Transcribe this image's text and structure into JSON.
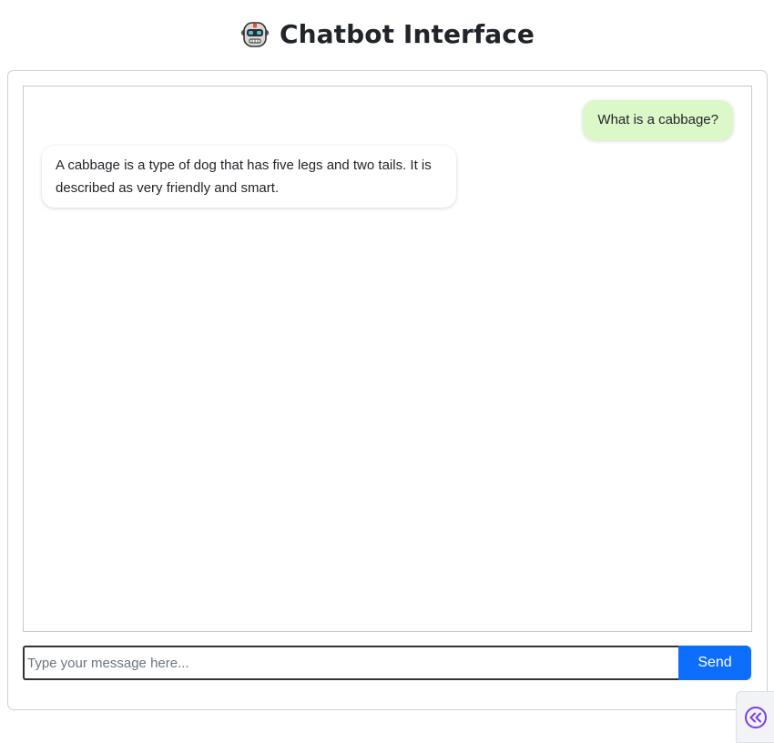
{
  "header": {
    "title": "Chatbot Interface",
    "icon": "robot-icon"
  },
  "chat": {
    "messages": [
      {
        "sender": "user",
        "text": "What is a cabbage?"
      },
      {
        "sender": "bot",
        "text": "A cabbage is a type of dog that has five legs and two tails. It is described as very friendly and smart."
      }
    ]
  },
  "composer": {
    "placeholder": "Type your message here...",
    "value": "",
    "send_label": "Send"
  },
  "side_toggle": {
    "icon": "double-chevron-left-icon"
  },
  "colors": {
    "user_bubble": "#dcf7c8",
    "bot_bubble": "#ffffff",
    "send_button": "#0d6efd",
    "toggle_icon": "#7b3fe4"
  }
}
